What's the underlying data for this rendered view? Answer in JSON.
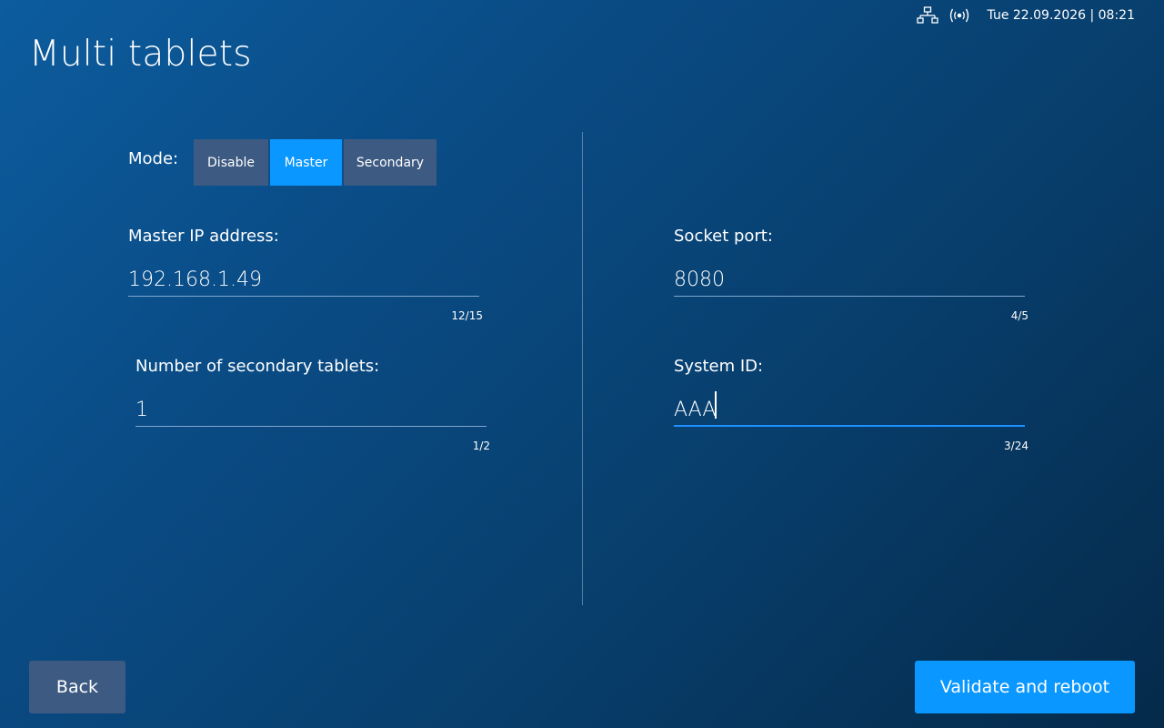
{
  "status": {
    "network_icon": "ethernet-network-icon",
    "wireless_icon": "wireless-signal-icon",
    "datetime": "Tue 22.09.2026 | 08:21"
  },
  "title": "Multi tablets",
  "mode": {
    "label": "Mode:",
    "options": [
      "Disable",
      "Master",
      "Secondary"
    ],
    "selected": "Master"
  },
  "fields": {
    "master_ip": {
      "label": "Master IP address:",
      "value": "192.168.1.49",
      "counter": "12/15"
    },
    "socket_port": {
      "label": "Socket port:",
      "value": "8080",
      "counter": "4/5"
    },
    "secondary_count": {
      "label": "Number of secondary tablets:",
      "value": "1",
      "counter": "1/2"
    },
    "system_id": {
      "label": "System ID:",
      "value": "AAA",
      "counter": "3/24"
    }
  },
  "buttons": {
    "back": "Back",
    "validate": "Validate and reboot"
  },
  "colors": {
    "accent": "#0a97ff",
    "inactive": "#3d5a82",
    "background_top": "#0c5c9e",
    "background_bottom": "#052a4a"
  }
}
